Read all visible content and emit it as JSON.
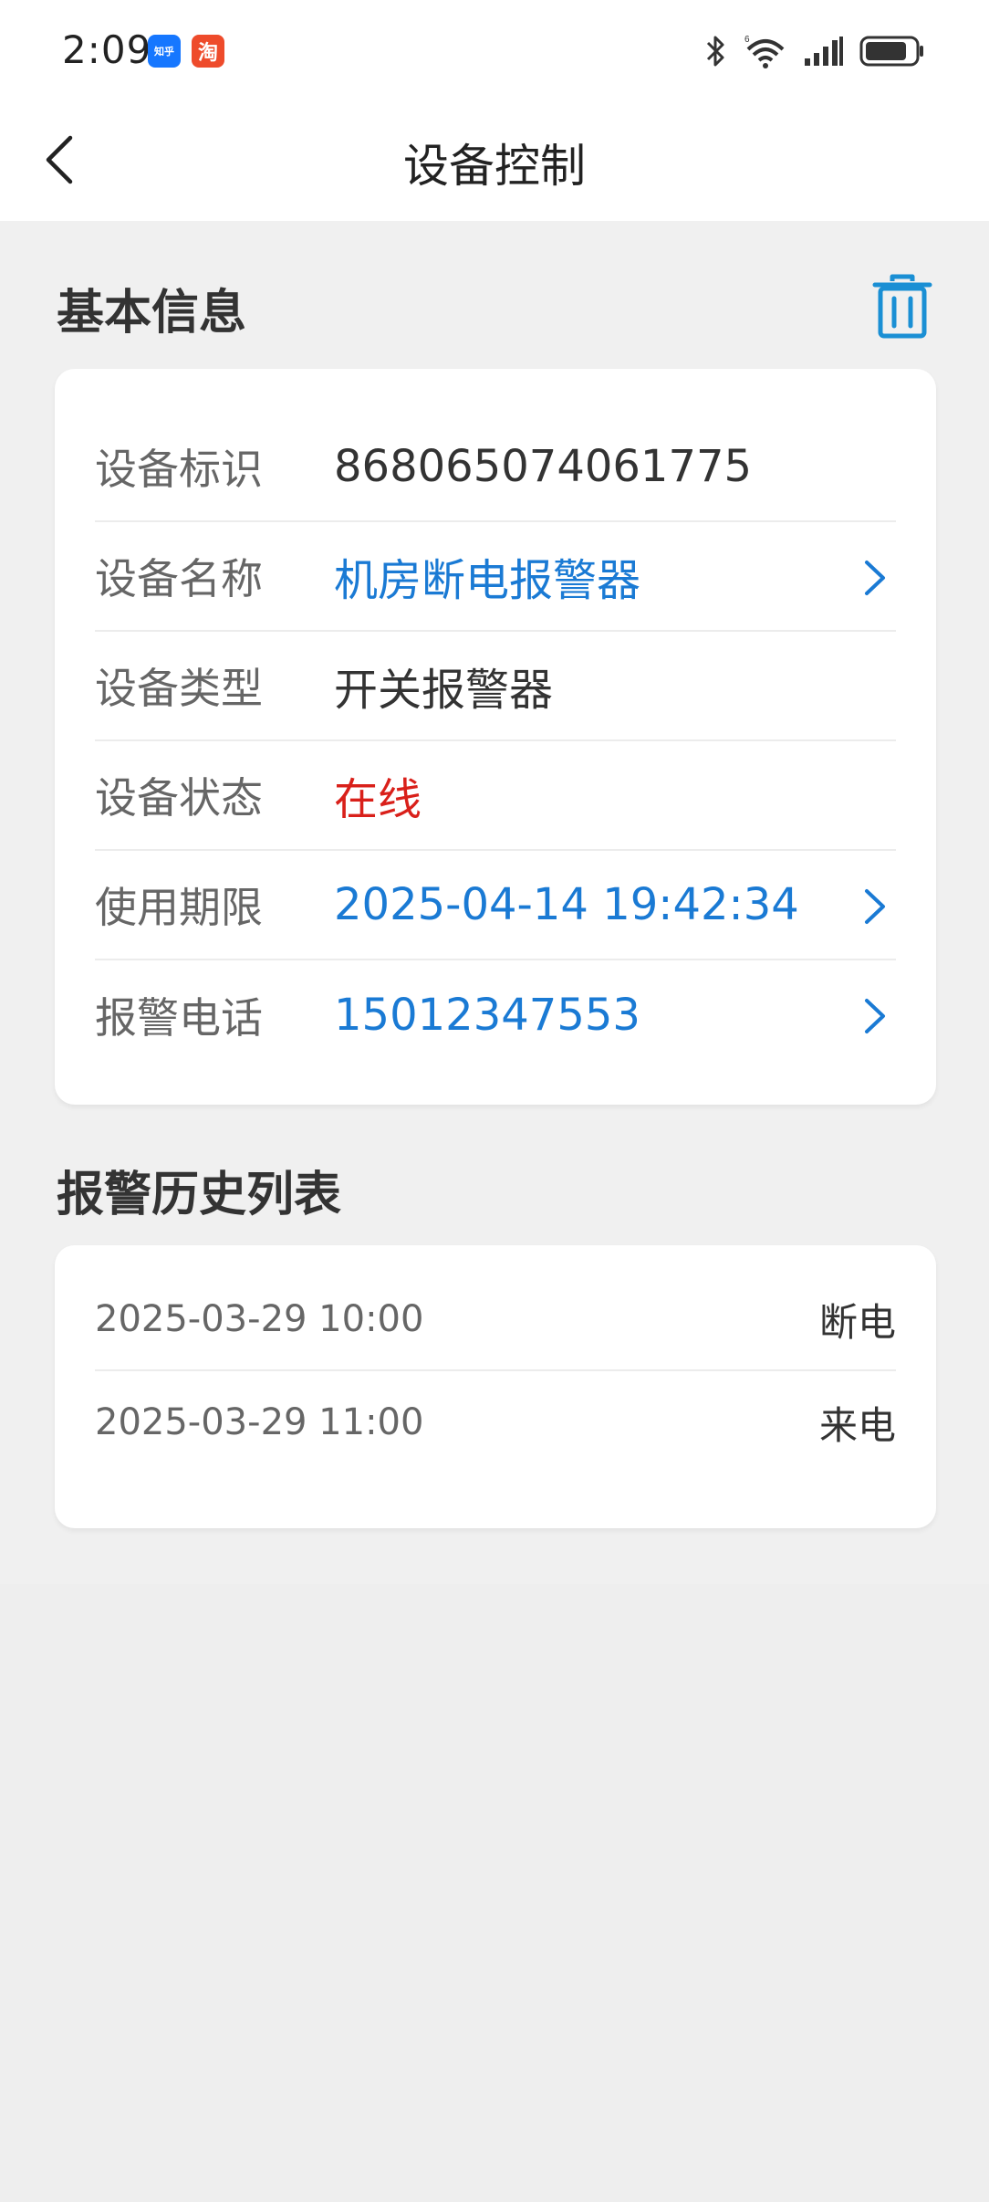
{
  "status_bar": {
    "time": "2:09",
    "badge_zhihu": "知乎",
    "badge_taobao": "淘",
    "icons": [
      "bluetooth-icon",
      "wifi-icon",
      "signal-icon",
      "battery-icon"
    ]
  },
  "nav": {
    "title": "设备控制"
  },
  "basic_info": {
    "title": "基本信息",
    "rows": [
      {
        "label": "设备标识",
        "value": "868065074061775"
      },
      {
        "label": "设备名称",
        "value": "机房断电报警器"
      },
      {
        "label": "设备类型",
        "value": "开关报警器"
      },
      {
        "label": "设备状态",
        "value": "在线"
      },
      {
        "label": "使用期限",
        "value": "2025-04-14 19:42:34"
      },
      {
        "label": "报警电话",
        "value": "15012347553"
      }
    ]
  },
  "history": {
    "title": "报警历史列表",
    "items": [
      {
        "time": "2025-03-29 10:00",
        "event": "断电"
      },
      {
        "time": "2025-03-29 11:00",
        "event": "来电"
      }
    ]
  },
  "colors": {
    "link": "#1a7ad4",
    "online": "#d9201a",
    "trash": "#1a8fd4"
  }
}
